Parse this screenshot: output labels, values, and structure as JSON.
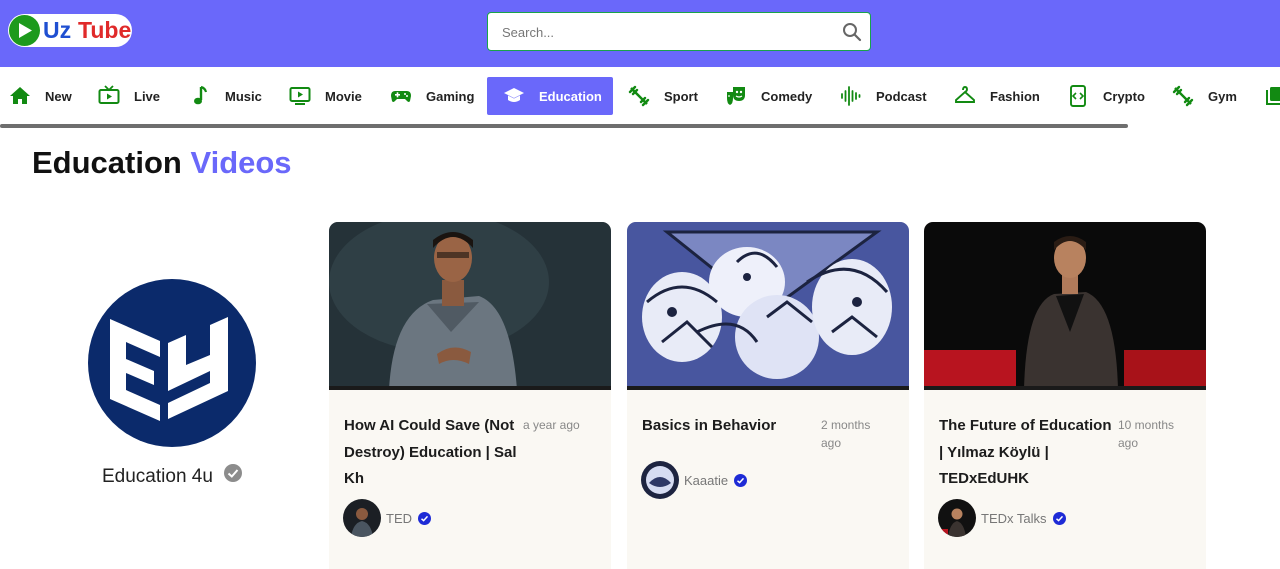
{
  "header": {
    "logo": {
      "part1": "Uz",
      "part2": "Tube"
    },
    "search": {
      "placeholder": "Search..."
    }
  },
  "categories": [
    {
      "label": "New",
      "icon": "home-icon"
    },
    {
      "label": "Live",
      "icon": "live-tv-icon"
    },
    {
      "label": "Music",
      "icon": "music-note-icon"
    },
    {
      "label": "Movie",
      "icon": "movie-screen-icon"
    },
    {
      "label": "Gaming",
      "icon": "gamepad-icon"
    },
    {
      "label": "Education",
      "icon": "graduation-cap-icon",
      "active": true
    },
    {
      "label": "Sport",
      "icon": "sport-dumbbell-icon"
    },
    {
      "label": "Comedy",
      "icon": "comedy-masks-icon"
    },
    {
      "label": "Podcast",
      "icon": "audio-wave-icon"
    },
    {
      "label": "Fashion",
      "icon": "hanger-icon"
    },
    {
      "label": "Crypto",
      "icon": "code-icon"
    },
    {
      "label": "Gym",
      "icon": "gym-dumbbell-icon"
    },
    {
      "label": "",
      "icon": "library-icon"
    }
  ],
  "page": {
    "title_main": "Education",
    "title_accent": "Videos"
  },
  "channel": {
    "name": "Education 4u",
    "verified": true
  },
  "videos": [
    {
      "title": "How AI Could Save (Not Destroy) Education | Sal Kh",
      "age": "a year ago",
      "author": "TED",
      "verified": true
    },
    {
      "title": "Basics in Behavior",
      "age": "2 months ago",
      "author": "Kaaatie",
      "verified": true
    },
    {
      "title": "The Future of Education | Yılmaz Köylü | TEDxEdUHK",
      "age": "10 months ago",
      "author": "TEDx Talks",
      "verified": true
    }
  ],
  "colors": {
    "brand": "#6a68fa",
    "icon_green": "#128a12",
    "verified_blue": "#1e2bd6",
    "channel_navy": "#0b2a6b"
  }
}
